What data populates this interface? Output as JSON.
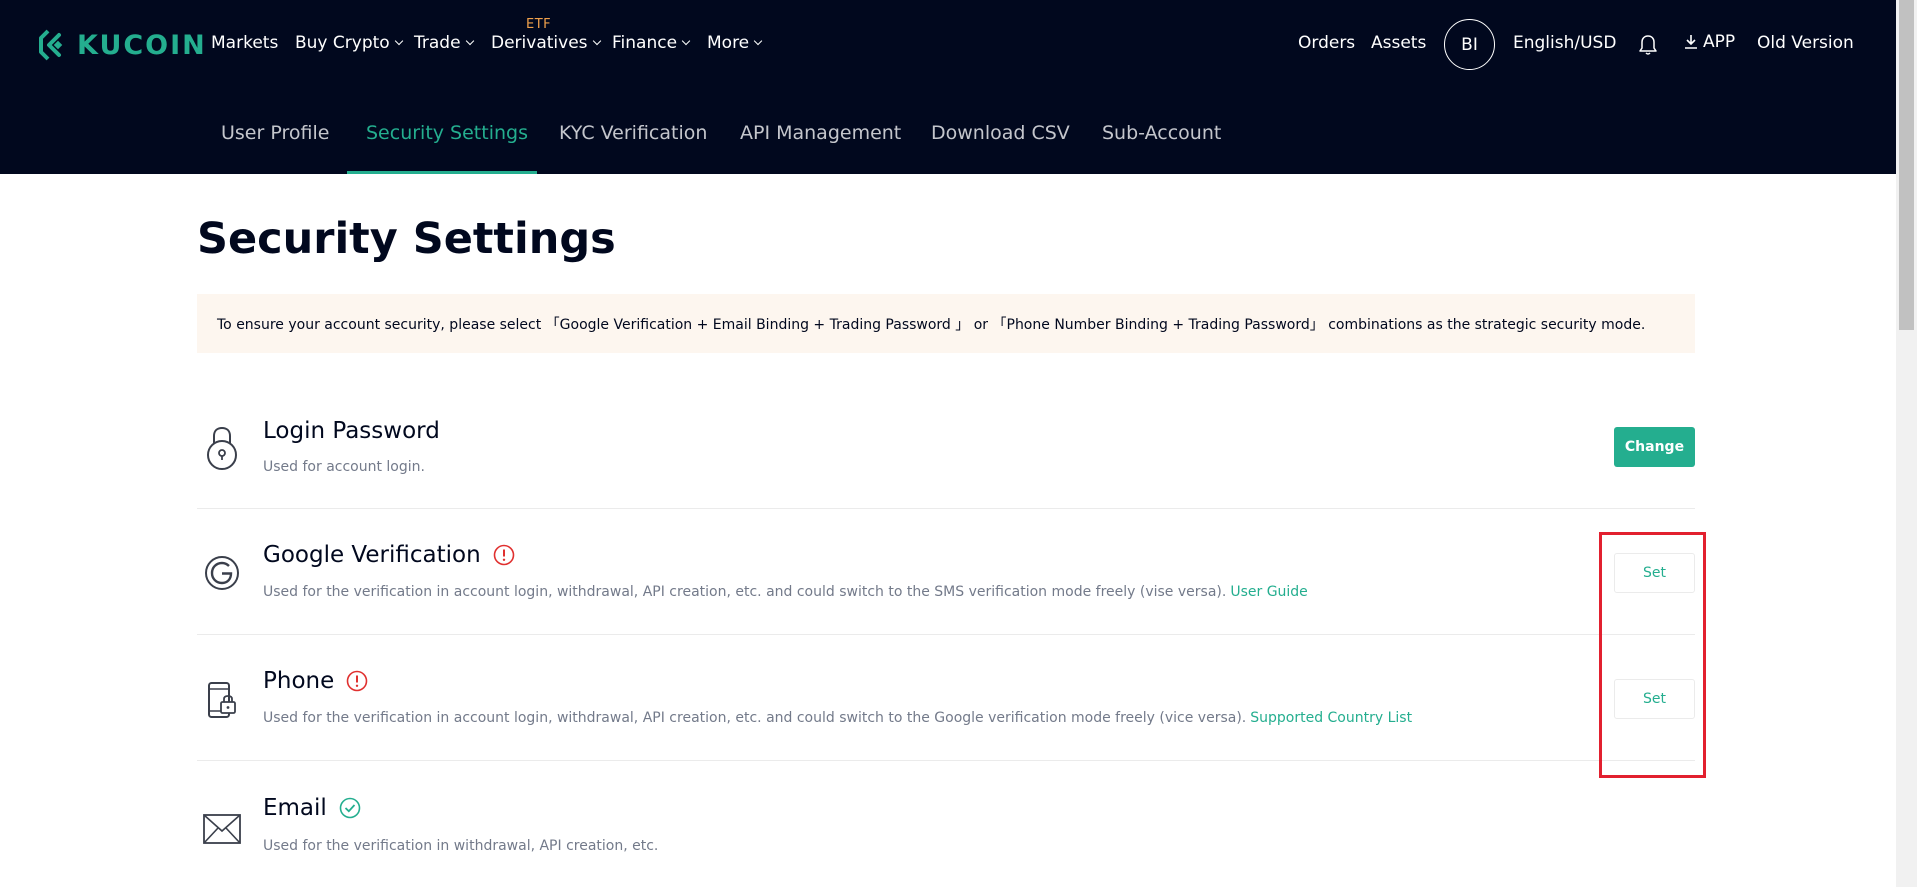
{
  "header": {
    "logo_text": "KUCOIN",
    "nav": [
      {
        "label": "Markets",
        "dropdown": false
      },
      {
        "label": "Buy Crypto",
        "dropdown": true
      },
      {
        "label": "Trade",
        "dropdown": true
      },
      {
        "label": "Derivatives",
        "dropdown": true,
        "badge": "ETF"
      },
      {
        "label": "Finance",
        "dropdown": true
      },
      {
        "label": "More",
        "dropdown": true
      }
    ],
    "right": {
      "orders": "Orders",
      "assets": "Assets",
      "avatar_initials": "BI",
      "language": "English/USD",
      "app": "APP",
      "old_version": "Old Version"
    },
    "icons": [
      "kucoin-logo-icon",
      "bell-icon",
      "download-icon"
    ]
  },
  "subnav": {
    "tabs": [
      {
        "label": "User Profile",
        "active": false
      },
      {
        "label": "Security Settings",
        "active": true
      },
      {
        "label": "KYC Verification",
        "active": false
      },
      {
        "label": "API Management",
        "active": false
      },
      {
        "label": "Download CSV",
        "active": false
      },
      {
        "label": "Sub-Account",
        "active": false
      }
    ]
  },
  "page": {
    "title": "Security Settings",
    "notice": "To ensure your account security, please select 「Google Verification + Email Binding + Trading Password 」 or 「Phone Number Binding + Trading Password」 combinations as the strategic security mode."
  },
  "settings": [
    {
      "icon": "lock-icon",
      "title": "Login Password",
      "desc": "Used for account login.",
      "status": "none",
      "action": "Change"
    },
    {
      "icon": "google-icon",
      "title": "Google Verification",
      "desc": "Used for the verification in account login, withdrawal, API creation, etc. and could switch to the SMS verification mode freely (vise versa).",
      "link": "User Guide",
      "status": "warning",
      "action": "Set"
    },
    {
      "icon": "phone-lock-icon",
      "title": "Phone",
      "desc": "Used for the verification in account login, withdrawal, API creation, etc. and could switch to the Google verification mode freely (vice versa).",
      "link": "Supported Country List",
      "status": "warning",
      "action": "Set"
    },
    {
      "icon": "envelope-icon",
      "title": "Email",
      "desc": "Used for the verification in withdrawal, API creation, etc.",
      "status": "verified"
    }
  ],
  "colors": {
    "header_bg": "#01081e",
    "accent": "#24ae8f",
    "warning": "#e0302f",
    "highlight": "#e2202f",
    "notice_bg": "#fdf6ef",
    "etf_badge": "#f0a04b"
  }
}
